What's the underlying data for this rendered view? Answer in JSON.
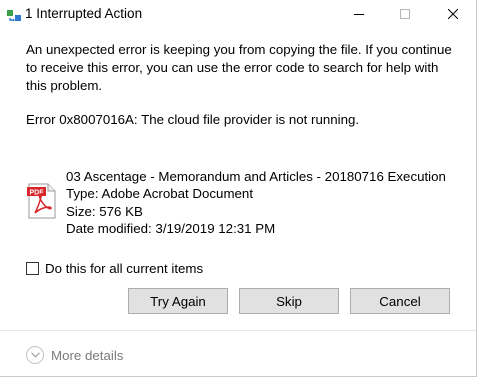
{
  "window": {
    "title": "1 Interrupted Action"
  },
  "message": {
    "body": "An unexpected error is keeping you from copying the file. If you continue to receive this error, you can use the error code to search for help with this problem.",
    "error": "Error 0x8007016A: The cloud file provider is not running."
  },
  "file": {
    "icon": "pdf-file-icon",
    "icon_label": "PDF",
    "name": "03 Ascentage - Memorandum and Articles - 20180716 Execution",
    "type": "Type: Adobe Acrobat Document",
    "size": "Size: 576 KB",
    "date_modified": "Date modified: 3/19/2019 12:31 PM"
  },
  "checkbox": {
    "label": "Do this for all current items",
    "checked": false
  },
  "buttons": {
    "try_again": "Try Again",
    "skip": "Skip",
    "cancel": "Cancel"
  },
  "footer": {
    "more_details": "More details"
  },
  "colors": {
    "button_bg": "#e1e1e1",
    "button_border": "#adadad",
    "pdf_red": "#d8262a",
    "muted_text": "#7a7a7a"
  }
}
